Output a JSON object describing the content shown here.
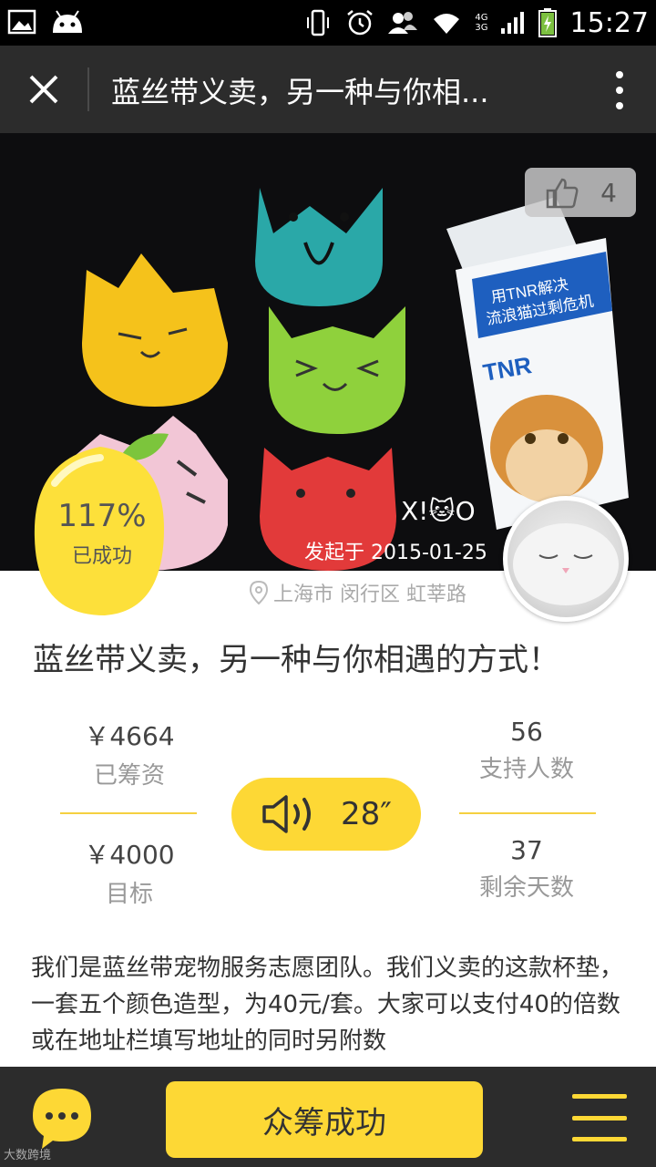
{
  "status_bar": {
    "time": "15:27",
    "network_top": "4G",
    "network_bottom": "3G",
    "icons": [
      "gallery-icon",
      "android-icon",
      "phone-vibrate-icon",
      "alarm-icon",
      "contacts-icon",
      "wifi-icon",
      "signal-icon",
      "battery-charging-icon"
    ]
  },
  "header": {
    "title": "蓝丝带义卖，另一种与你相...",
    "close_icon": "close-icon",
    "more_icon": "more-vertical-icon"
  },
  "hero": {
    "like_count": "4",
    "author": "X!🐱O",
    "start_date": "发起于 2015-01-25",
    "booklet_line1": "用TNR解决",
    "booklet_line2": "流浪猫过剩危机",
    "booklet_brand": "TNR"
  },
  "badge": {
    "percent": "117%",
    "label": "已成功"
  },
  "location": "上海市 闵行区 虹莘路",
  "project_title": "蓝丝带义卖，另一种与你相遇的方式！",
  "stats": {
    "raised_value": "￥4664",
    "raised_label": "已筹资",
    "backers_value": "56",
    "backers_label": "支持人数",
    "goal_value": "￥4000",
    "goal_label": "目标",
    "days_value": "37",
    "days_label": "剩余天数"
  },
  "audio": {
    "duration": "28″"
  },
  "description": "我们是蓝丝带宠物服务志愿团队。我们义卖的这款杯垫，一套五个颜色造型，为40元/套。大家可以支付40的倍数或在地址栏填写地址的同时另附数",
  "bottom": {
    "primary_label": "众筹成功",
    "watermark": "大数跨境"
  },
  "colors": {
    "accent_yellow": "#fdd835",
    "dark_bar": "#2c2c2c"
  }
}
